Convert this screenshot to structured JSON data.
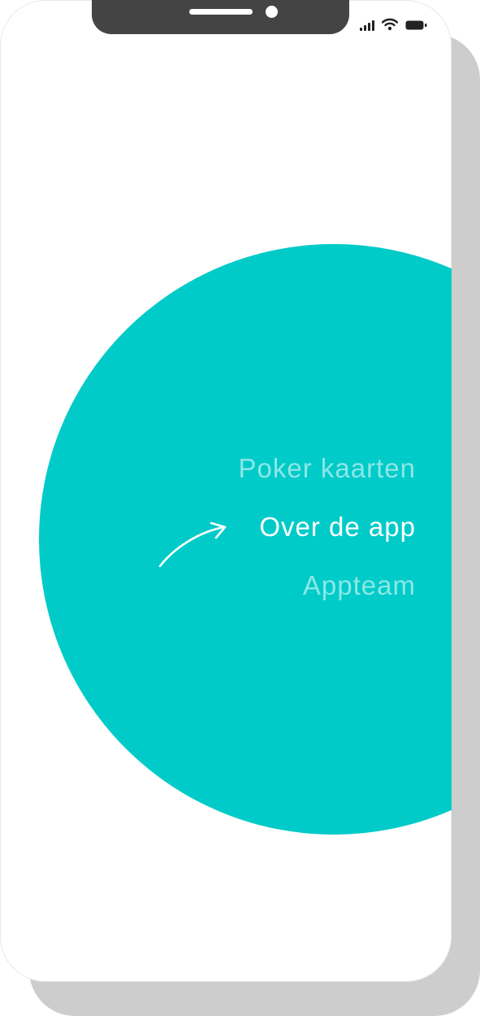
{
  "menu": {
    "items": [
      {
        "label": "Poker kaarten",
        "active": false
      },
      {
        "label": "Over de app",
        "active": true
      },
      {
        "label": "Appteam",
        "active": false
      }
    ]
  },
  "status_bar": {
    "icons": [
      "cellular-signal-icon",
      "wifi-icon",
      "battery-icon"
    ]
  },
  "colors": {
    "accent": "#00cbc8",
    "frame_shadow": "#cdcdcd",
    "notch": "#444444"
  }
}
